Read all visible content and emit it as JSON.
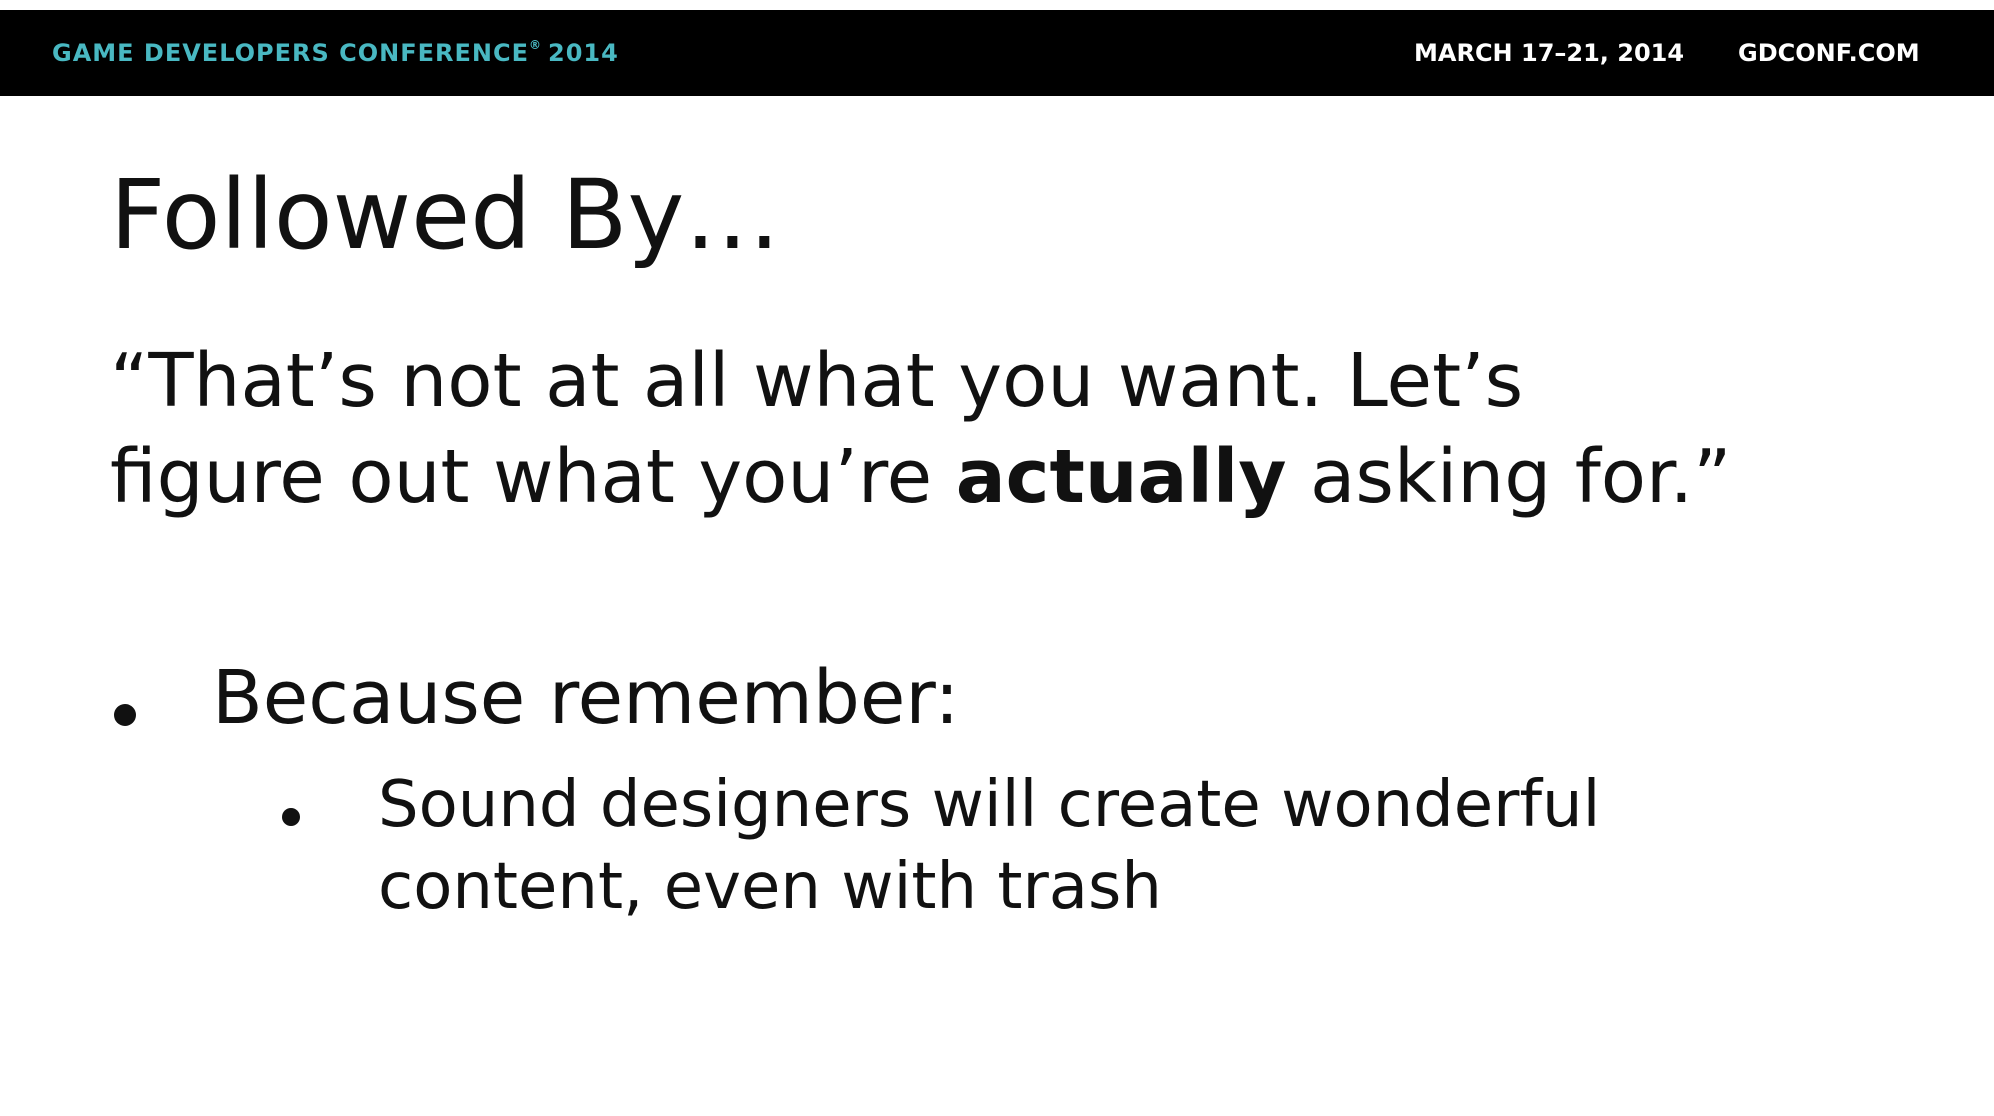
{
  "header": {
    "conference_name": "GAME DEVELOPERS CONFERENCE",
    "registered_mark": "®",
    "conference_year": "2014",
    "dates": "MARCH 17–21, 2014",
    "website": "GDCONF.COM"
  },
  "slide": {
    "title": "Followed By…",
    "quote": {
      "line1": "“That’s not at all what you want.  Let’s",
      "line2_before": "figure out what you’re ",
      "line2_bold": "actually",
      "line2_after": " asking for.”"
    },
    "bullets": [
      {
        "text": "Because remember:",
        "sub_bullets": [
          {
            "line1": "Sound designers will create wonderful",
            "line2": "content, even with trash"
          }
        ]
      }
    ]
  },
  "colors": {
    "header_background": "#000000",
    "brand_accent": "#49b8c2",
    "header_text": "#ffffff",
    "body_text": "#111111",
    "slide_background": "#ffffff"
  }
}
